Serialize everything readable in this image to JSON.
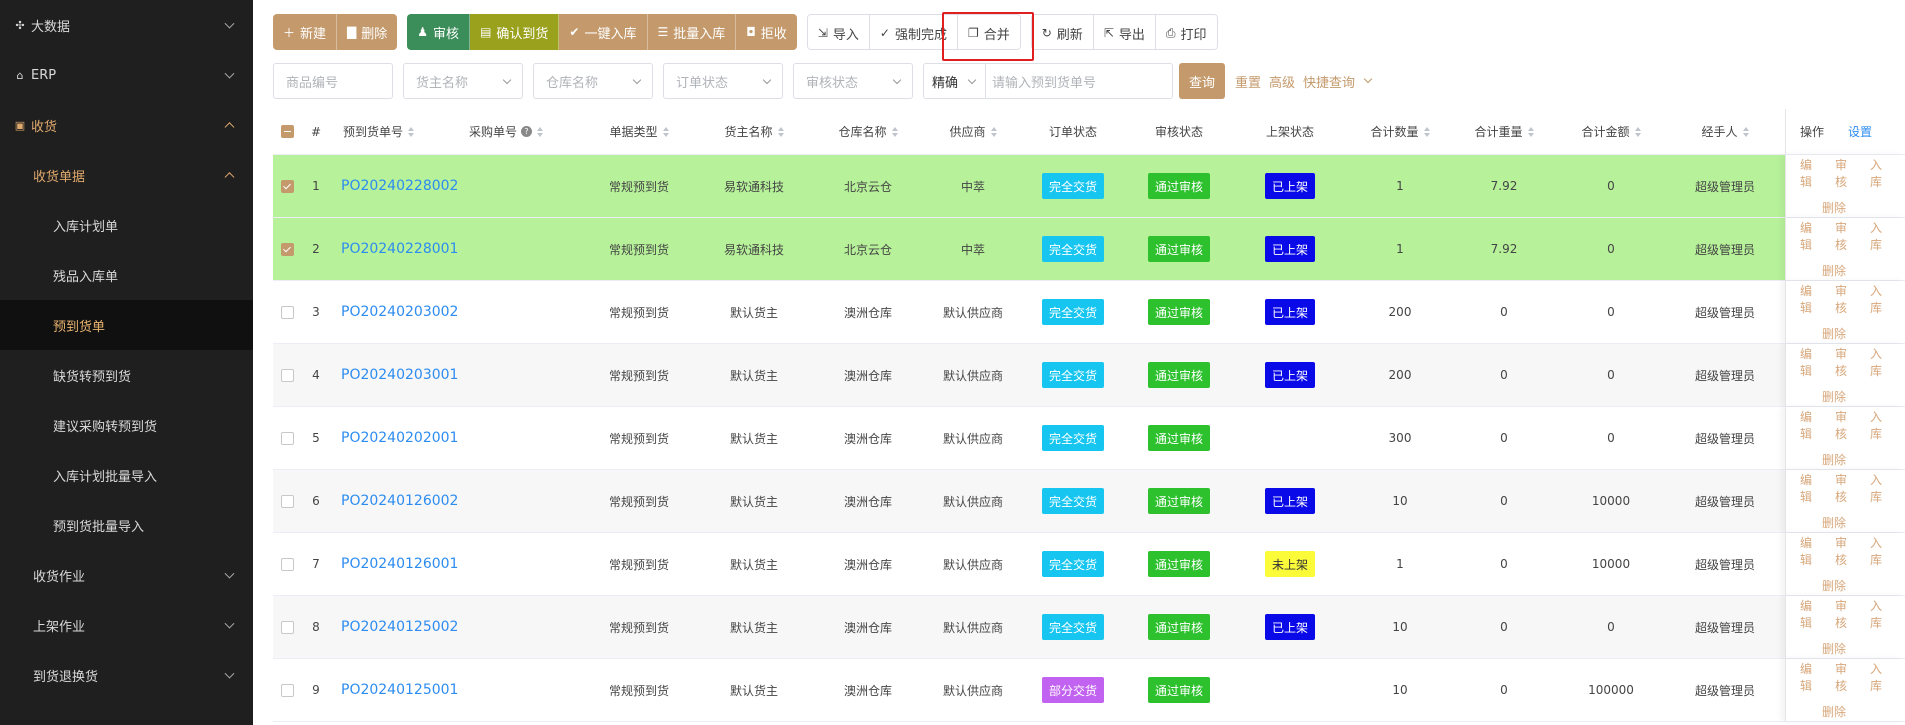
{
  "sidebar": {
    "items": [
      {
        "label": "大数据",
        "icon": "network-icon"
      },
      {
        "label": "ERP",
        "icon": "bank-icon"
      },
      {
        "label": "收货",
        "icon": "box-icon"
      },
      {
        "label": "收货单据"
      },
      {
        "label": "入库计划单"
      },
      {
        "label": "残品入库单"
      },
      {
        "label": "预到货单"
      },
      {
        "label": "缺货转预到货"
      },
      {
        "label": "建议采购转预到货"
      },
      {
        "label": "入库计划批量导入"
      },
      {
        "label": "预到货批量导入"
      },
      {
        "label": "收货作业"
      },
      {
        "label": "上架作业"
      },
      {
        "label": "到货退换货"
      }
    ]
  },
  "toolbar": {
    "new": "新建",
    "delete": "删除",
    "audit": "审核",
    "confirm_arrival": "确认到货",
    "one_click_store": "一键入库",
    "batch_store": "批量入库",
    "reject": "拒收",
    "import": "导入",
    "force_complete": "强制完成",
    "merge": "合并",
    "refresh": "刷新",
    "export": "导出",
    "print": "打印"
  },
  "filters": {
    "product_code": "商品编号",
    "owner": "货主名称",
    "warehouse": "仓库名称",
    "order_status": "订单状态",
    "audit_status": "审核状态",
    "match_mode": "精确",
    "search_placeholder": "请输入预到货单号",
    "query": "查询",
    "reset": "重置",
    "advanced": "高级",
    "quick_query": "快捷查询"
  },
  "table": {
    "headers": {
      "idx": "#",
      "no": "预到货单号",
      "po": "采购单号",
      "type": "单据类型",
      "owner": "货主名称",
      "warehouse": "仓库名称",
      "supplier": "供应商",
      "order_status": "订单状态",
      "audit_status": "审核状态",
      "shelf_status": "上架状态",
      "qty": "合计数量",
      "weight": "合计重量",
      "amount": "合计金额",
      "handler": "经手人",
      "ops": "操作",
      "settings": "设置"
    },
    "ops": {
      "edit": "编辑",
      "audit": "审核",
      "store": "入库",
      "delete": "删除"
    },
    "rows": [
      {
        "idx": "1",
        "no": "PO20240228002",
        "type": "常规预到货",
        "owner": "易软通科技",
        "warehouse": "北京云仓",
        "supplier": "中萃",
        "order_status": "完全交货",
        "audit_status": "通过审核",
        "shelf_status": "已上架",
        "qty": "1",
        "weight": "7.92",
        "amount": "0",
        "handler": "超级管理员"
      },
      {
        "idx": "2",
        "no": "PO20240228001",
        "type": "常规预到货",
        "owner": "易软通科技",
        "warehouse": "北京云仓",
        "supplier": "中萃",
        "order_status": "完全交货",
        "audit_status": "通过审核",
        "shelf_status": "已上架",
        "qty": "1",
        "weight": "7.92",
        "amount": "0",
        "handler": "超级管理员"
      },
      {
        "idx": "3",
        "no": "PO20240203002",
        "type": "常规预到货",
        "owner": "默认货主",
        "warehouse": "澳洲仓库",
        "supplier": "默认供应商",
        "order_status": "完全交货",
        "audit_status": "通过审核",
        "shelf_status": "已上架",
        "qty": "200",
        "weight": "0",
        "amount": "0",
        "handler": "超级管理员"
      },
      {
        "idx": "4",
        "no": "PO20240203001",
        "type": "常规预到货",
        "owner": "默认货主",
        "warehouse": "澳洲仓库",
        "supplier": "默认供应商",
        "order_status": "完全交货",
        "audit_status": "通过审核",
        "shelf_status": "已上架",
        "qty": "200",
        "weight": "0",
        "amount": "0",
        "handler": "超级管理员"
      },
      {
        "idx": "5",
        "no": "PO20240202001",
        "type": "常规预到货",
        "owner": "默认货主",
        "warehouse": "澳洲仓库",
        "supplier": "默认供应商",
        "order_status": "完全交货",
        "audit_status": "通过审核",
        "shelf_status": "",
        "qty": "300",
        "weight": "0",
        "amount": "0",
        "handler": "超级管理员"
      },
      {
        "idx": "6",
        "no": "PO20240126002",
        "type": "常规预到货",
        "owner": "默认货主",
        "warehouse": "澳洲仓库",
        "supplier": "默认供应商",
        "order_status": "完全交货",
        "audit_status": "通过审核",
        "shelf_status": "已上架",
        "qty": "10",
        "weight": "0",
        "amount": "10000",
        "handler": "超级管理员"
      },
      {
        "idx": "7",
        "no": "PO20240126001",
        "type": "常规预到货",
        "owner": "默认货主",
        "warehouse": "澳洲仓库",
        "supplier": "默认供应商",
        "order_status": "完全交货",
        "audit_status": "通过审核",
        "shelf_status": "未上架",
        "qty": "1",
        "weight": "0",
        "amount": "10000",
        "handler": "超级管理员"
      },
      {
        "idx": "8",
        "no": "PO20240125002",
        "type": "常规预到货",
        "owner": "默认货主",
        "warehouse": "澳洲仓库",
        "supplier": "默认供应商",
        "order_status": "完全交货",
        "audit_status": "通过审核",
        "shelf_status": "已上架",
        "qty": "10",
        "weight": "0",
        "amount": "0",
        "handler": "超级管理员"
      },
      {
        "idx": "9",
        "no": "PO20240125001",
        "type": "常规预到货",
        "owner": "默认货主",
        "warehouse": "澳洲仓库",
        "supplier": "默认供应商",
        "order_status": "部分交货",
        "audit_status": "通过审核",
        "shelf_status": "",
        "qty": "10",
        "weight": "0",
        "amount": "100000",
        "handler": "超级管理员"
      }
    ]
  },
  "colors": {
    "accent": "#c49a6c",
    "selected_row": "#b7f29a",
    "tag_full": "#17c6f0",
    "tag_partial": "#c262f0",
    "tag_audit": "#2ec12e",
    "tag_shelved": "#0a0ae8",
    "tag_unshelved": "#fbfb3a",
    "link": "#2d8cf0"
  }
}
